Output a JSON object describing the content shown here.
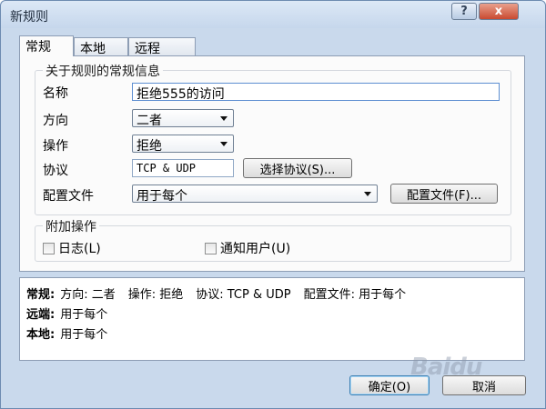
{
  "window": {
    "title": "新规则"
  },
  "title_buttons": {
    "help": "?",
    "close": "x"
  },
  "tabs": [
    {
      "label": "常规",
      "active": true
    },
    {
      "label": "本地",
      "active": false
    },
    {
      "label": "远程",
      "active": false
    }
  ],
  "general_group": {
    "legend": "关于规则的常规信息",
    "name_label": "名称",
    "name_value": "拒绝555的访问",
    "direction_label": "方向",
    "direction_value": "二者",
    "action_label": "操作",
    "action_value": "拒绝",
    "protocol_label": "协议",
    "protocol_value": "TCP & UDP",
    "select_protocol_button": "选择协议(S)...",
    "profile_label": "配置文件",
    "profile_value": "用于每个",
    "profile_button": "配置文件(F)..."
  },
  "extra_group": {
    "legend": "附加操作",
    "log_label": "日志(L)",
    "notify_label": "通知用户(U)"
  },
  "summary": {
    "general_key": "常规:",
    "direction": "方向: 二者",
    "action": "操作: 拒绝",
    "protocol": "协议: TCP & UDP",
    "profile": "配置文件: 用于每个",
    "remote_key": "远端:",
    "remote_value": "用于每个",
    "local_key": "本地:",
    "local_value": "用于每个"
  },
  "footer": {
    "ok": "确定(O)",
    "cancel": "取消"
  },
  "watermark": "Baidu"
}
